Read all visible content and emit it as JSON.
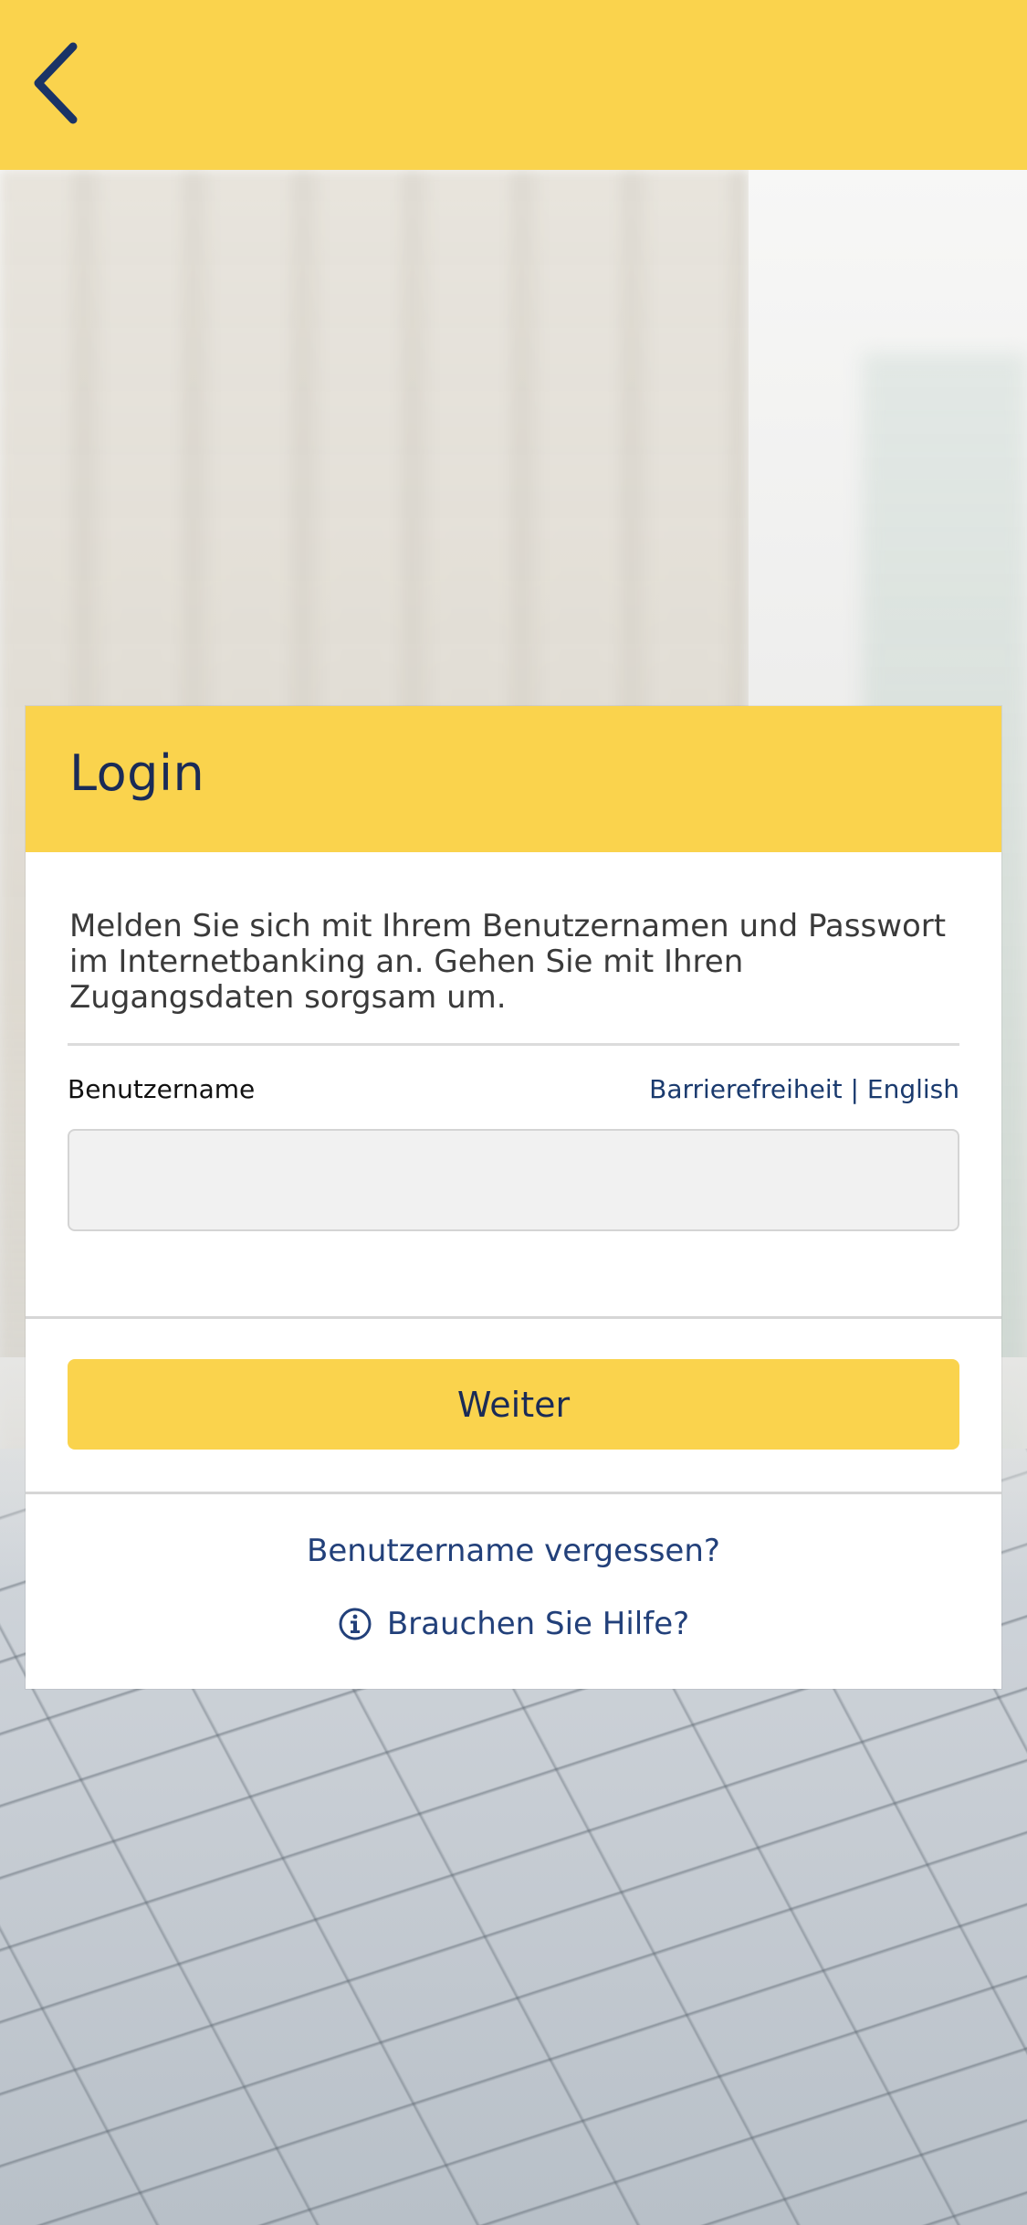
{
  "app": {
    "accent": "#fad34d",
    "text_dark_blue": "#1a2b57",
    "link_blue": "#22407a"
  },
  "nav": {
    "back_icon": "chevron-left-icon"
  },
  "login": {
    "title": "Login",
    "intro": "Melden Sie sich mit Ihrem Benutzernamen und Passwort im Internetbanking an. Gehen Sie mit Ihren Zugangsdaten sorgsam um.",
    "username_label": "Benutzername",
    "username_value": "",
    "username_placeholder": "",
    "link_accessibility": "Barrierefreiheit",
    "link_separator": "|",
    "link_english": "English",
    "submit_label": "Weiter",
    "forgot_label": "Benutzername vergessen?",
    "help_label": "Brauchen Sie Hilfe?",
    "help_icon": "info-icon"
  }
}
